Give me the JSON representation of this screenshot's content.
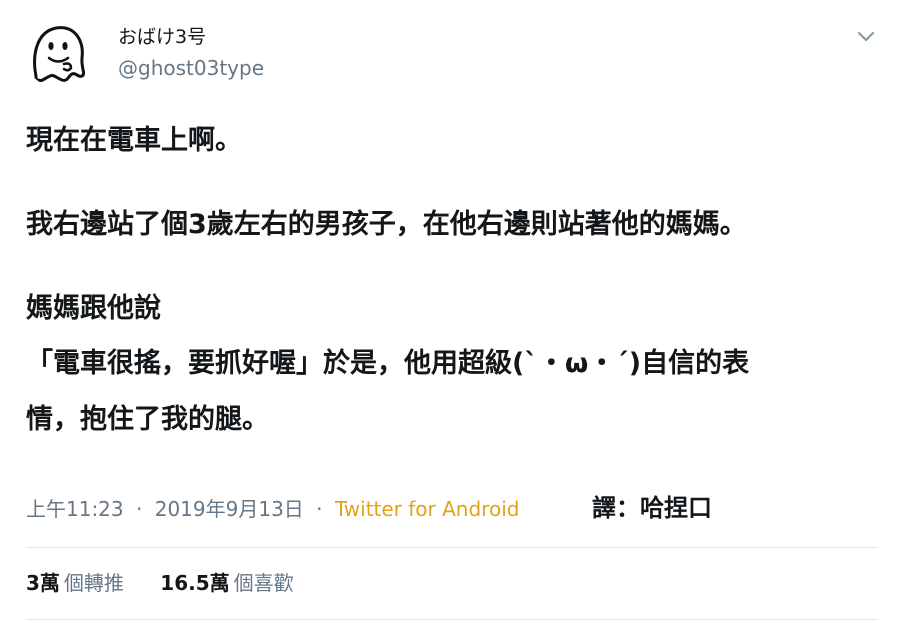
{
  "author": {
    "display_name": "おばけ3号",
    "username": "@ghost03type",
    "avatar_icon": "ghost-icon"
  },
  "tweet": {
    "lines": [
      "現在在電車上啊。",
      "我右邊站了個3歲左右的男孩子，在他右邊則站著他的媽媽。",
      "媽媽跟他說",
      "「電車很搖，要抓好喔」於是，他用超級(`・ω・´)自信的表",
      "情，抱住了我的腿。"
    ]
  },
  "meta": {
    "time": "上午11:23",
    "separator": "·",
    "date": "2019年9月13日",
    "source": "Twitter for Android",
    "source_color": "#e0a31a"
  },
  "translator": "譯：哈捏口",
  "stats": {
    "retweets_count": "3萬",
    "retweets_label": "個轉推",
    "likes_count": "16.5萬",
    "likes_label": "個喜歡"
  },
  "menu": {
    "icon": "chevron-down-icon"
  }
}
